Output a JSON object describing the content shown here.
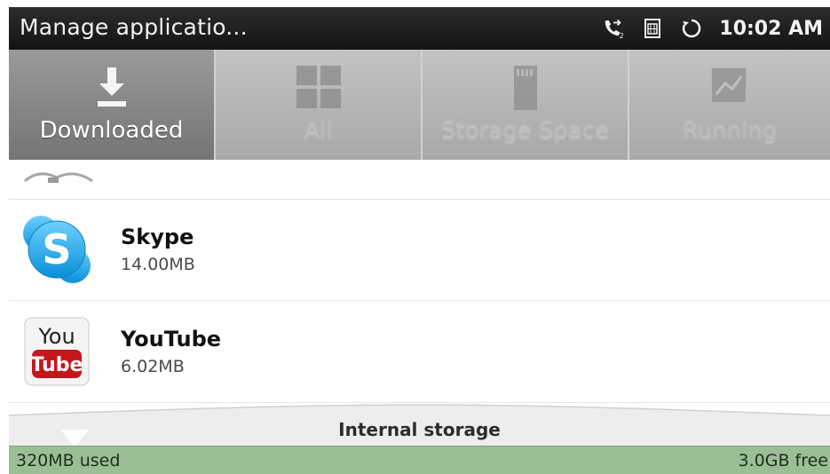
{
  "status_bar": {
    "title": "Manage applicatio...",
    "icons": [
      "call-forward-icon",
      "sim-card-icon",
      "sync-icon"
    ],
    "call_forward_badge": "2",
    "time": "10:02 AM"
  },
  "tabs": [
    {
      "label": "Downloaded",
      "icon": "download-icon",
      "selected": true
    },
    {
      "label": "All",
      "icon": "grid-icon",
      "selected": false
    },
    {
      "label": "Storage Space",
      "icon": "sd-card-icon",
      "selected": false
    },
    {
      "label": "Running",
      "icon": "running-apps-icon",
      "selected": false
    }
  ],
  "apps": [
    {
      "name": "Skype",
      "size": "14.00MB",
      "icon": "skype-icon"
    },
    {
      "name": "YouTube",
      "size": "6.02MB",
      "icon": "youtube-icon",
      "icon_text_top": "You",
      "icon_text_bottom": "Tube"
    }
  ],
  "storage": {
    "label": "Internal storage",
    "used": "320MB used",
    "free": "3.0GB free",
    "bar_color": "#9bbe96"
  }
}
